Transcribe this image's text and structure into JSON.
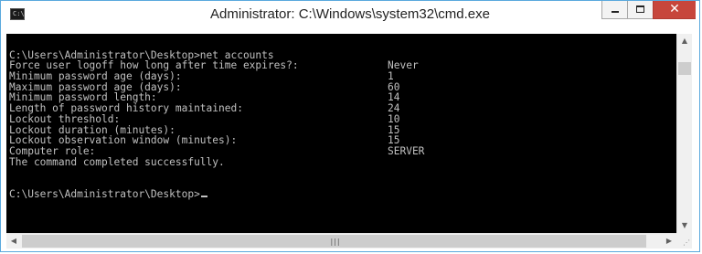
{
  "window": {
    "title": "Administrator: C:\\Windows\\system32\\cmd.exe",
    "icon": "cmd-icon",
    "icon_glyph": "C:\\",
    "buttons": {
      "minimize": "minimize-icon",
      "maximize": "maximize-icon",
      "close": "close-icon",
      "close_glyph": "✕"
    }
  },
  "console": {
    "background": "#000000",
    "foreground": "#c0c0c0",
    "lines": [
      {
        "text": "",
        "value": ""
      },
      {
        "text": "C:\\Users\\Administrator\\Desktop>net accounts",
        "value": ""
      },
      {
        "text": "Force user logoff how long after time expires?:",
        "value": "Never"
      },
      {
        "text": "Minimum password age (days):",
        "value": "1"
      },
      {
        "text": "Maximum password age (days):",
        "value": "60"
      },
      {
        "text": "Minimum password length:",
        "value": "14"
      },
      {
        "text": "Length of password history maintained:",
        "value": "24"
      },
      {
        "text": "Lockout threshold:",
        "value": "10"
      },
      {
        "text": "Lockout duration (minutes):",
        "value": "15"
      },
      {
        "text": "Lockout observation window (minutes):",
        "value": "15"
      },
      {
        "text": "Computer role:",
        "value": "SERVER"
      },
      {
        "text": "The command completed successfully.",
        "value": ""
      },
      {
        "text": "",
        "value": ""
      },
      {
        "text": "",
        "value": ""
      },
      {
        "text": "C:\\Users\\Administrator\\Desktop>",
        "value": ""
      }
    ]
  },
  "scrollbars": {
    "vertical": {
      "up": "▲",
      "down": "▼"
    },
    "horizontal": {
      "left": "◀",
      "right": "▶",
      "grip": "|||"
    },
    "size_grip": "⋰"
  }
}
